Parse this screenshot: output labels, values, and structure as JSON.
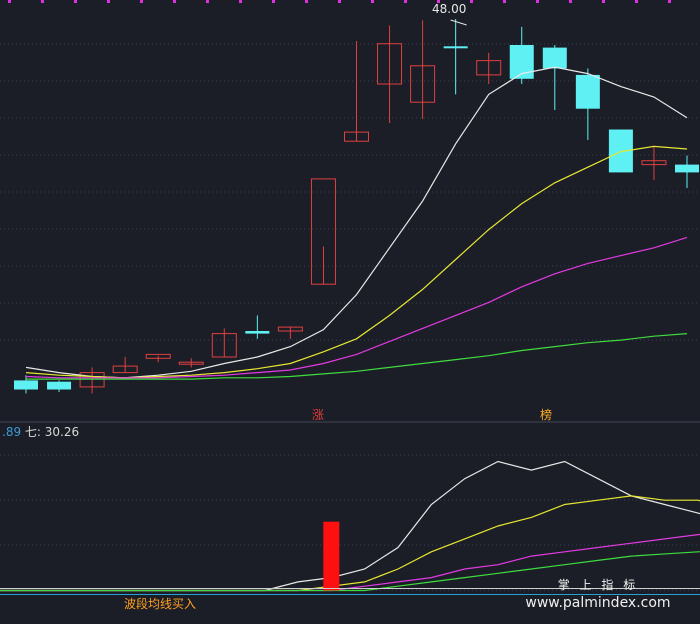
{
  "colors": {
    "bg": "#1b1e26",
    "grid": "#3a3f55",
    "up": "#e04040",
    "down": "#5ef0f2",
    "ma1": "#e8e8e8",
    "ma2": "#e6e632",
    "ma3": "#e23ae2",
    "ma4": "#3fdc3f",
    "marker": "#e030e0",
    "lower_cyan": "#2a9fd6",
    "watermark": "#f0f0f0",
    "badge_text": "#e03a3a",
    "badge_text2": "#ffb020",
    "lower_label": "#3d9bd8",
    "lower_label2": "#d8d8d8"
  },
  "top_panel": {
    "max_annotation": "48.00",
    "badges": [
      "涨",
      "榜"
    ]
  },
  "bottom_panel": {
    "label_prefix": ".89",
    "label_main": "七: 30.26",
    "overlay_text": "波段均线买入",
    "watermark_cn": "掌 上 指 标",
    "watermark_url": "www.palmindex.com"
  },
  "chart_data": [
    {
      "type": "candlestick",
      "title": "",
      "x": [
        1,
        2,
        3,
        4,
        5,
        6,
        7,
        8,
        9,
        10,
        11,
        12,
        13,
        14,
        15,
        16,
        17,
        18,
        19,
        20,
        21
      ],
      "ohlc": [
        [
          20.2,
          20.6,
          19.2,
          19.5
        ],
        [
          20.1,
          20.2,
          19.3,
          19.5
        ],
        [
          19.7,
          21.2,
          19.2,
          20.8
        ],
        [
          20.8,
          22.0,
          20.8,
          21.3
        ],
        [
          21.9,
          22.1,
          21.6,
          22.2
        ],
        [
          21.5,
          21.9,
          21.2,
          21.6
        ],
        [
          22.0,
          24.2,
          22.0,
          23.8
        ],
        [
          24.0,
          25.2,
          23.4,
          23.8
        ],
        [
          24.0,
          24.3,
          23.4,
          24.3
        ],
        [
          27.6,
          30.5,
          27.6,
          35.7
        ],
        [
          38.6,
          46.3,
          38.6,
          39.3
        ],
        [
          43.0,
          47.5,
          40.0,
          46.1
        ],
        [
          41.6,
          47.9,
          40.3,
          44.4
        ],
        [
          45.9,
          48.0,
          42.2,
          45.8
        ],
        [
          43.7,
          45.4,
          43.0,
          44.8
        ],
        [
          46.0,
          47.4,
          43.0,
          43.4
        ],
        [
          45.8,
          46.0,
          41.0,
          44.2
        ],
        [
          43.7,
          44.2,
          38.7,
          41.1
        ],
        [
          39.5,
          39.5,
          36.2,
          36.2
        ],
        [
          36.8,
          38.2,
          35.6,
          37.1
        ],
        [
          36.8,
          37.5,
          35.0,
          36.2
        ]
      ],
      "ma_series": [
        {
          "values": [
            21.2,
            20.8,
            20.5,
            20.4,
            20.6,
            20.9,
            21.5,
            22.0,
            22.8,
            24.1,
            26.8,
            30.4,
            34.0,
            38.4,
            42.2,
            43.8,
            44.3,
            43.8,
            42.8,
            42.0,
            40.4
          ]
        },
        {
          "values": [
            20.8,
            20.6,
            20.5,
            20.4,
            20.5,
            20.6,
            20.8,
            21.1,
            21.5,
            22.4,
            23.4,
            25.2,
            27.2,
            29.5,
            31.8,
            33.8,
            35.4,
            36.6,
            37.8,
            38.2,
            38.0
          ]
        },
        {
          "values": [
            20.5,
            20.4,
            20.4,
            20.4,
            20.4,
            20.5,
            20.6,
            20.8,
            21.0,
            21.5,
            22.2,
            23.2,
            24.2,
            25.2,
            26.2,
            27.4,
            28.4,
            29.2,
            29.8,
            30.4,
            31.2
          ]
        },
        {
          "values": [
            20.3,
            20.3,
            20.3,
            20.3,
            20.3,
            20.3,
            20.4,
            20.4,
            20.5,
            20.7,
            20.9,
            21.2,
            21.5,
            21.8,
            22.1,
            22.5,
            22.8,
            23.1,
            23.3,
            23.6,
            23.8
          ]
        }
      ],
      "ylim": [
        19.0,
        49.0
      ]
    },
    {
      "type": "line",
      "title": "",
      "x": [
        0,
        1,
        2,
        3,
        4,
        5,
        6,
        7,
        8,
        9,
        10,
        11,
        12,
        13,
        14,
        15,
        16,
        17,
        18,
        19,
        20,
        21,
        22
      ],
      "series": [
        {
          "values": [
            0.0,
            0.0,
            0.0,
            0.0,
            0.0,
            0.0,
            0.0,
            0.0,
            0.0,
            0.2,
            0.3,
            0.5,
            1.0,
            2.0,
            2.6,
            3.0,
            2.8,
            3.0,
            2.6,
            2.2,
            2.0,
            1.8,
            1.6
          ]
        },
        {
          "values": [
            0.0,
            0.0,
            0.0,
            0.0,
            0.0,
            0.0,
            0.0,
            0.0,
            0.0,
            0.0,
            0.1,
            0.2,
            0.5,
            0.9,
            1.2,
            1.5,
            1.7,
            2.0,
            2.1,
            2.2,
            2.1,
            2.1,
            1.9
          ]
        },
        {
          "values": [
            0.0,
            0.0,
            0.0,
            0.0,
            0.0,
            0.0,
            0.0,
            0.0,
            0.0,
            0.0,
            0.0,
            0.1,
            0.2,
            0.3,
            0.5,
            0.6,
            0.8,
            0.9,
            1.0,
            1.1,
            1.2,
            1.3,
            1.4
          ]
        },
        {
          "values": [
            0.0,
            0.0,
            0.0,
            0.0,
            0.0,
            0.0,
            0.0,
            0.0,
            0.0,
            0.0,
            0.0,
            0.0,
            0.1,
            0.2,
            0.3,
            0.4,
            0.5,
            0.6,
            0.7,
            0.8,
            0.85,
            0.9,
            0.95
          ]
        }
      ],
      "bar": {
        "x": 10,
        "value": 1.6
      },
      "ylim": [
        -0.5,
        3.5
      ]
    }
  ]
}
